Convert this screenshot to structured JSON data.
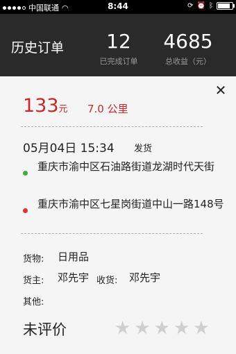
{
  "status_bar": {
    "carrier": "中国联通",
    "time": "8:44"
  },
  "header": {
    "title": "历史订单",
    "completed_orders": "12",
    "completed_orders_label": "已完成订单",
    "total_income": "4685",
    "total_income_label": "总收益（元）"
  },
  "order": {
    "price": "133",
    "price_unit": "元",
    "distance": "7.0 公里",
    "datetime": "05月04日 15:34",
    "status": "发货",
    "from_address": "重庆市渝中区石油路街道龙湖时代天街",
    "to_address": "重庆市渝中区七星岗街道中山一路148号",
    "goods_label": "货物:",
    "goods_value": "日用品",
    "owner_label": "货主:",
    "owner_value": "邓先宇",
    "receiver_label": "收货:",
    "receiver_value": "邓先宇",
    "other_label": "其他:",
    "other_value": "",
    "rating_label": "未评价",
    "rating": 0,
    "rating_max": 5
  },
  "icons": {
    "close": "close-icon",
    "star": "star-icon"
  }
}
